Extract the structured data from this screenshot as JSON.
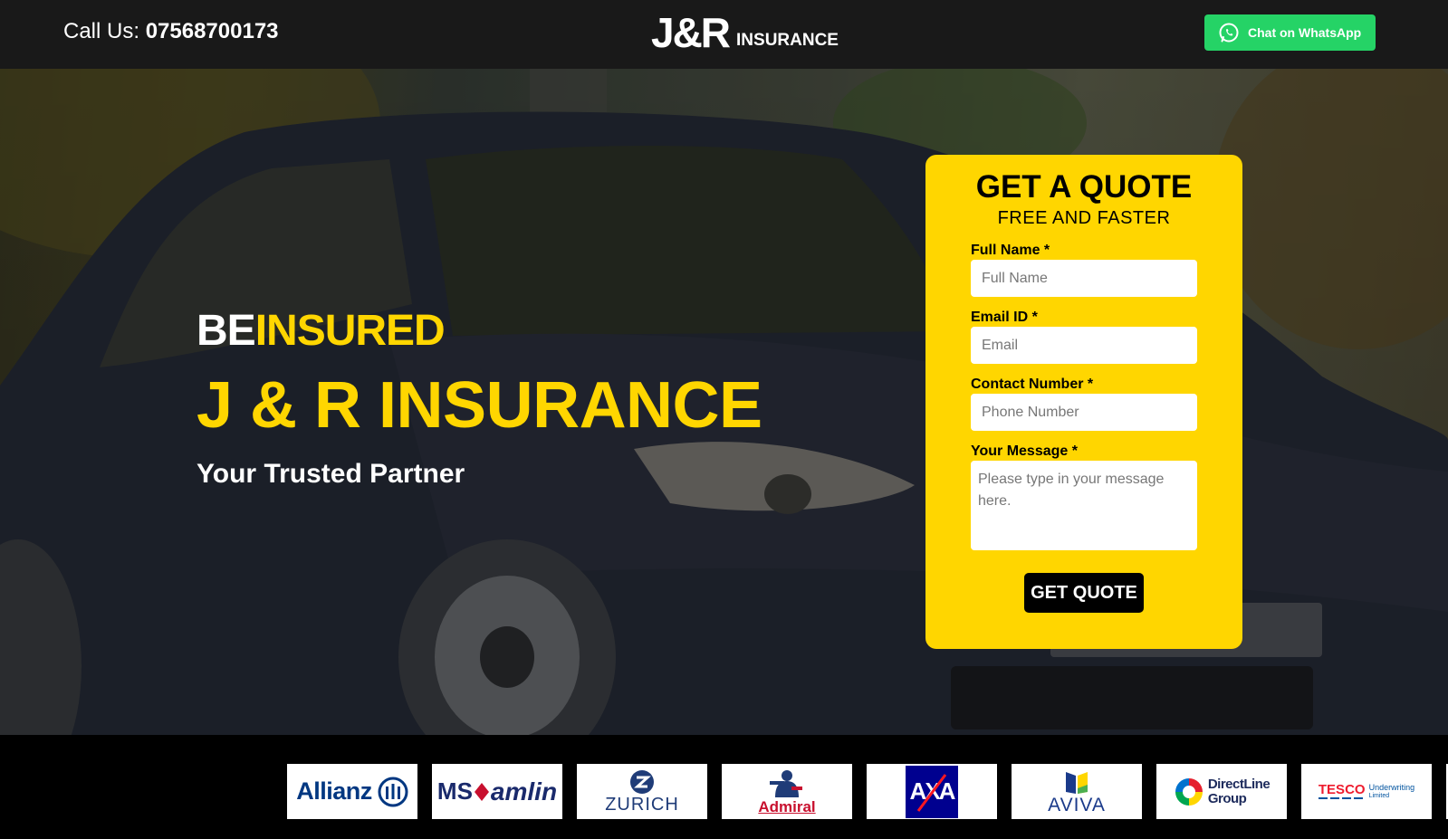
{
  "header": {
    "call_prefix": "Call Us:",
    "phone": "07568700173",
    "logo_mark": "J&R",
    "logo_word": "INSURANCE",
    "whatsapp_label": "Chat on WhatsApp",
    "whatsapp_color": "#25d366"
  },
  "hero": {
    "be": "BE",
    "insured": "INSURED",
    "title": "J & R INSURANCE",
    "tagline": "Your Trusted Partner",
    "accent_color": "#ffd600"
  },
  "quote_form": {
    "title": "GET A QUOTE",
    "subtitle": "FREE AND FASTER",
    "fields": [
      {
        "label": "Full Name *",
        "placeholder": "Full Name"
      },
      {
        "label": "Email ID *",
        "placeholder": "Email"
      },
      {
        "label": "Contact Number *",
        "placeholder": "Phone Number"
      },
      {
        "label": "Your Message *",
        "placeholder": "Please type in your message here."
      }
    ],
    "submit_label": "GET QUOTE",
    "background_color": "#ffd600"
  },
  "partners": [
    {
      "name": "Allianz",
      "color": "#003781"
    },
    {
      "name": "MS",
      "name2": "amlin",
      "color": "#1a2a6c"
    },
    {
      "name": "ZURICH",
      "color": "#1f3c78"
    },
    {
      "name": "Admiral",
      "color": "#c8102e"
    },
    {
      "name": "AXA",
      "color": "#00008f"
    },
    {
      "name": "AVIVA",
      "color": "#1a3a8a"
    },
    {
      "name": "DirectLine",
      "name2": "Group",
      "color": "#1d2b5c"
    },
    {
      "name": "TESCO",
      "name2": "Underwriting",
      "name3": "Limited",
      "color": "#ee1c2e"
    }
  ]
}
